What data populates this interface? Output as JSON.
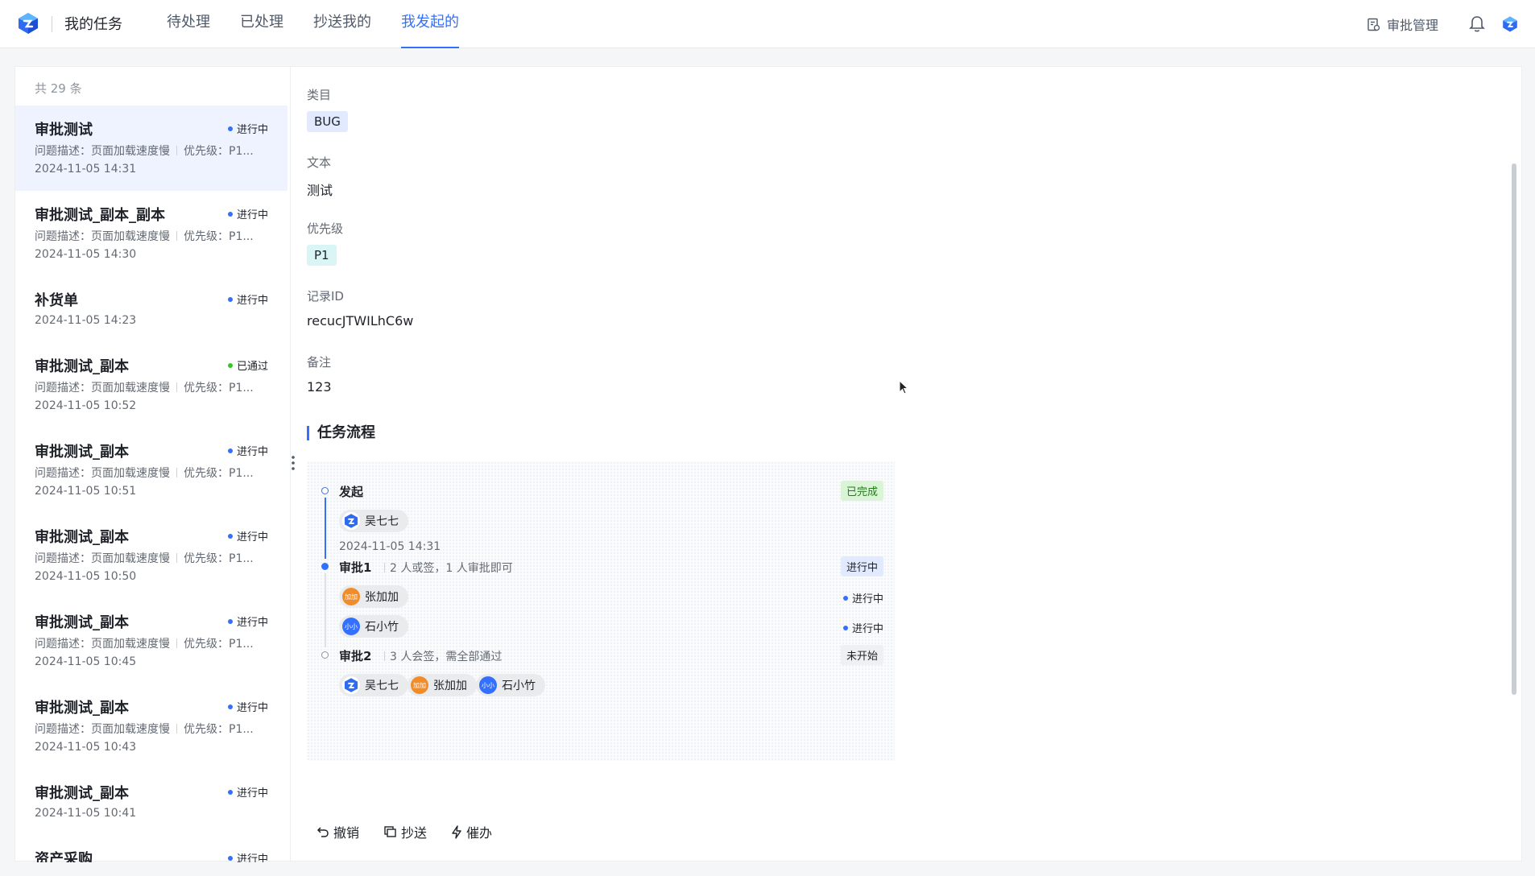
{
  "header": {
    "app_title": "我的任务",
    "tabs": [
      {
        "label": "待处理",
        "active": false
      },
      {
        "label": "已处理",
        "active": false
      },
      {
        "label": "抄送我的",
        "active": false
      },
      {
        "label": "我发起的",
        "active": true
      }
    ],
    "approval_mgmt_label": "审批管理",
    "accent_color": "#3370ff"
  },
  "list": {
    "count_label": "共 29 条",
    "items": [
      {
        "title": "审批测试",
        "status": "进行中",
        "status_color": "blue",
        "desc_left": "问题描述：页面加载速度慢",
        "desc_right": "优先级：P1...",
        "time": "2024-11-05 14:31",
        "selected": true
      },
      {
        "title": "审批测试_副本_副本",
        "status": "进行中",
        "status_color": "blue",
        "desc_left": "问题描述：页面加载速度慢",
        "desc_right": "优先级：P1...",
        "time": "2024-11-05 14:30"
      },
      {
        "title": "补货单",
        "status": "进行中",
        "status_color": "blue",
        "desc_left": "",
        "desc_right": "",
        "time": "2024-11-05 14:23"
      },
      {
        "title": "审批测试_副本",
        "status": "已通过",
        "status_color": "green",
        "desc_left": "问题描述：页面加载速度慢",
        "desc_right": "优先级：P1...",
        "time": "2024-11-05 10:52"
      },
      {
        "title": "审批测试_副本",
        "status": "进行中",
        "status_color": "blue",
        "desc_left": "问题描述：页面加载速度慢",
        "desc_right": "优先级：P1...",
        "time": "2024-11-05 10:51"
      },
      {
        "title": "审批测试_副本",
        "status": "进行中",
        "status_color": "blue",
        "desc_left": "问题描述：页面加载速度慢",
        "desc_right": "优先级：P1...",
        "time": "2024-11-05 10:50"
      },
      {
        "title": "审批测试_副本",
        "status": "进行中",
        "status_color": "blue",
        "desc_left": "问题描述：页面加载速度慢",
        "desc_right": "优先级：P1...",
        "time": "2024-11-05 10:45"
      },
      {
        "title": "审批测试_副本",
        "status": "进行中",
        "status_color": "blue",
        "desc_left": "问题描述：页面加载速度慢",
        "desc_right": "优先级：P1...",
        "time": "2024-11-05 10:43"
      },
      {
        "title": "审批测试_副本",
        "status": "进行中",
        "status_color": "blue",
        "desc_left": "",
        "desc_right": "",
        "time": "2024-11-05 10:41"
      },
      {
        "title": "资产采购",
        "status": "进行中",
        "status_color": "blue",
        "desc_left": "",
        "desc_right": "",
        "time": ""
      }
    ]
  },
  "detail": {
    "fields": [
      {
        "label": "类目",
        "value": "BUG",
        "kind": "tag-bug"
      },
      {
        "label": "文本",
        "value": "测试",
        "kind": "text"
      },
      {
        "label": "优先级",
        "value": "P1",
        "kind": "tag-p1"
      },
      {
        "label": "记录ID",
        "value": "recucJTWILhC6w",
        "kind": "text"
      },
      {
        "label": "备注",
        "value": "123",
        "kind": "text"
      }
    ],
    "flow_title": "任务流程",
    "flow": {
      "start": {
        "title": "发起",
        "badge": "已完成",
        "person": "吴七七",
        "time": "2024-11-05 14:31"
      },
      "approve1": {
        "title": "审批1",
        "rule": "2 人或签，1 人审批即可",
        "badge": "进行中",
        "people": [
          {
            "name": "张加加",
            "avatar_text": "加加",
            "status": "进行中"
          },
          {
            "name": "石小竹",
            "avatar_text": "小小",
            "status": "进行中"
          }
        ]
      },
      "approve2": {
        "title": "审批2",
        "rule": "3 人会签，需全部通过",
        "badge": "未开始",
        "people": [
          {
            "name": "吴七七",
            "avatar_text": ""
          },
          {
            "name": "张加加",
            "avatar_text": "加加"
          },
          {
            "name": "石小竹",
            "avatar_text": "小小"
          }
        ]
      }
    },
    "actions": [
      {
        "label": "撤销",
        "icon": "undo-icon"
      },
      {
        "label": "抄送",
        "icon": "copy-icon"
      },
      {
        "label": "催办",
        "icon": "lightning-icon"
      }
    ]
  }
}
